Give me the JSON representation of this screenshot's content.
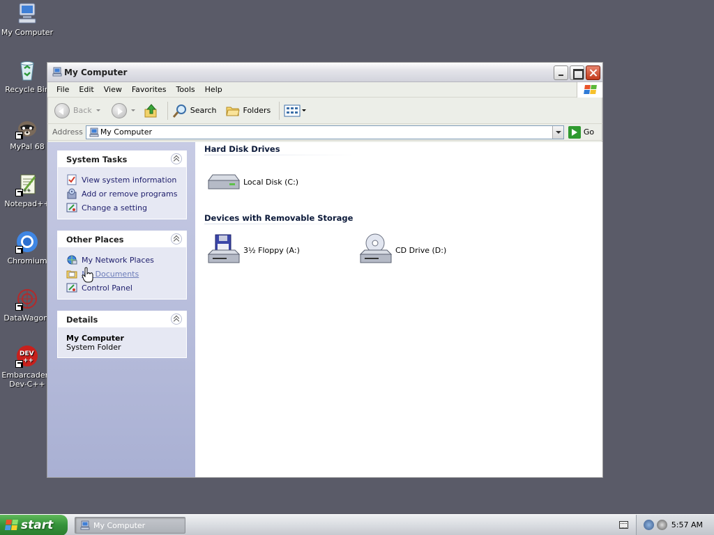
{
  "desktop": {
    "icons": [
      {
        "label": "My Computer"
      },
      {
        "label": "Recycle Bin"
      },
      {
        "label": "MyPal 68"
      },
      {
        "label": "Notepad++"
      },
      {
        "label": "Chromium"
      },
      {
        "label": "DataWagon."
      },
      {
        "label": "Embarcadero Dev-C++"
      }
    ]
  },
  "window": {
    "title": "My Computer",
    "menu": [
      "File",
      "Edit",
      "View",
      "Favorites",
      "Tools",
      "Help"
    ],
    "toolbar": {
      "back": "Back",
      "search": "Search",
      "folders": "Folders"
    },
    "address": {
      "label": "Address",
      "value": "My Computer",
      "go": "Go"
    },
    "taskpane": {
      "system_tasks": {
        "title": "System Tasks",
        "items": [
          "View system information",
          "Add or remove programs",
          "Change a setting"
        ]
      },
      "other_places": {
        "title": "Other Places",
        "items": [
          "My Network Places",
          "My Documents",
          "Control Panel"
        ]
      },
      "details": {
        "title": "Details",
        "name": "My Computer",
        "type": "System Folder"
      }
    },
    "content": {
      "groups": [
        {
          "title": "Hard Disk Drives",
          "items": [
            "Local Disk (C:)"
          ]
        },
        {
          "title": "Devices with Removable Storage",
          "items": [
            "3½ Floppy (A:)",
            "CD Drive (D:)"
          ]
        }
      ]
    }
  },
  "taskbar": {
    "start": "start",
    "task": "My Computer",
    "clock": "5:57 AM"
  },
  "colors": {
    "desktop": "#5a5b68",
    "link": "#1d1d6b",
    "start": "#34923a"
  }
}
